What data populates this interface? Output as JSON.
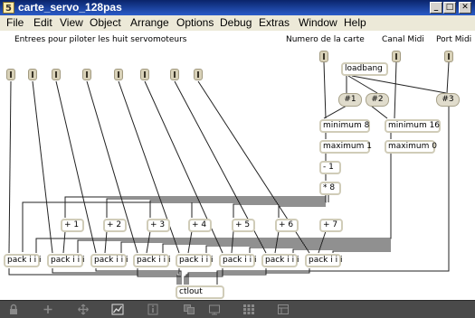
{
  "window": {
    "title": "carte_servo_128pas",
    "icon_glyph": "5",
    "min_label": "_",
    "max_label": "□",
    "close_label": "✕"
  },
  "menu": [
    "File",
    "Edit",
    "View",
    "Object",
    "Arrange",
    "Options",
    "Debug",
    "Extras",
    "Window",
    "Help"
  ],
  "comments": {
    "servo_inputs": "Entrees pour piloter les huit servomoteurs",
    "card_number": "Numero de la carte",
    "midi_channel": "Canal Midi",
    "midi_port": "Port Midi"
  },
  "objects": {
    "loadbang": "loadbang",
    "msg1": "#1",
    "msg2": "#2",
    "msg3": "#3",
    "minimum8": "minimum 8",
    "maximum1": "maximum 1",
    "minus1": "- 1",
    "times8": "* 8",
    "minimum16": "minimum 16",
    "maximum0": "maximum 0",
    "plus1": "+ 1",
    "plus2": "+ 2",
    "plus3": "+ 3",
    "plus4": "+ 4",
    "plus5": "+ 5",
    "plus6": "+ 6",
    "plus7": "+ 7",
    "pack": "pack i i i",
    "ctlout": "ctlout"
  },
  "toolbar": {
    "lock": "lock-icon",
    "add": "add-icon",
    "move": "move-icon",
    "graph": "graph-icon",
    "info": "info-icon",
    "copy": "copy-icon",
    "grid": "grid-icon",
    "presentation": "presentation-icon"
  }
}
